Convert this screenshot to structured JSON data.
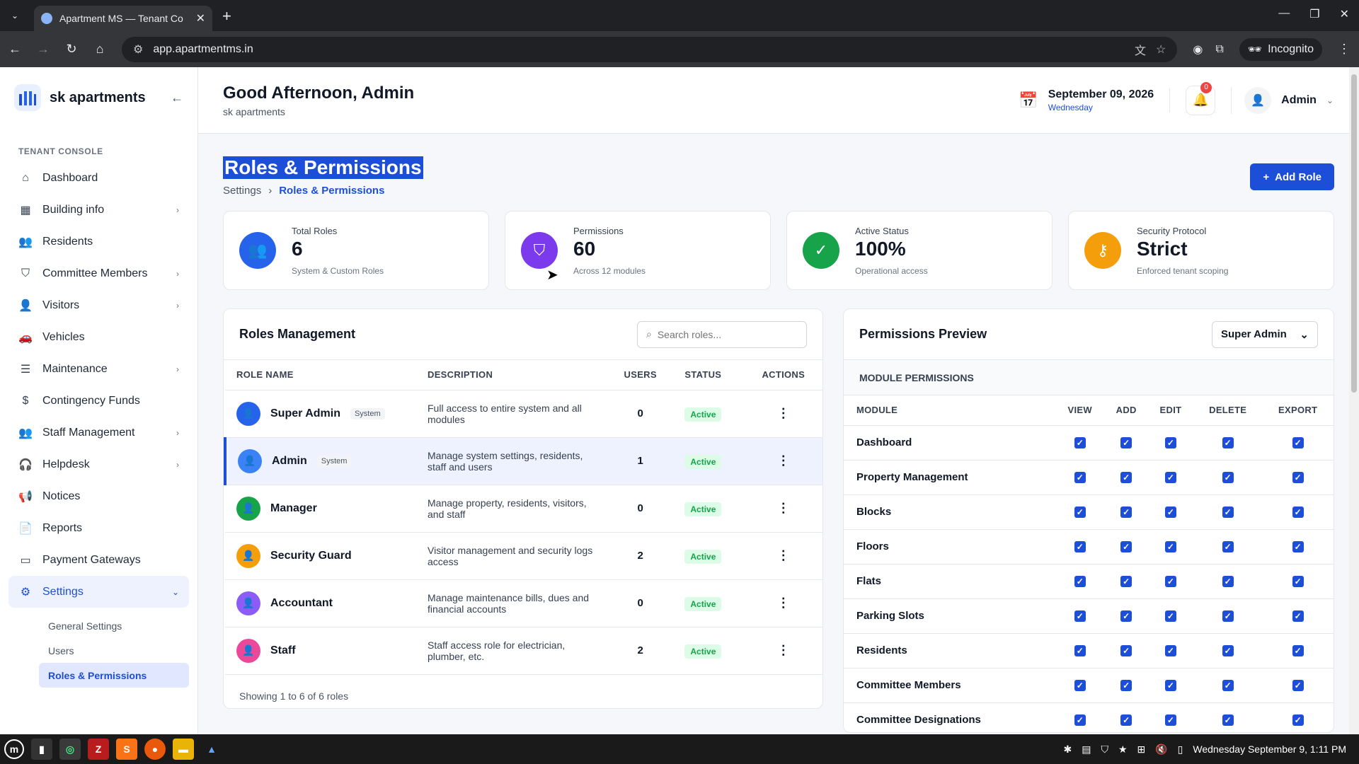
{
  "browser": {
    "tab_title": "Apartment MS — Tenant Co",
    "url": "app.apartmentms.in",
    "incognito_label": "Incognito"
  },
  "sidebar": {
    "brand": "sk apartments",
    "section": "TENANT CONSOLE",
    "items": [
      {
        "label": "Dashboard",
        "icon": "home-icon",
        "glyph": "⌂",
        "chevron": false
      },
      {
        "label": "Building info",
        "icon": "grid-icon",
        "glyph": "▦",
        "chevron": true
      },
      {
        "label": "Residents",
        "icon": "users-icon",
        "glyph": "👥",
        "chevron": false
      },
      {
        "label": "Committee Members",
        "icon": "shield-icon",
        "glyph": "⛉",
        "chevron": true
      },
      {
        "label": "Visitors",
        "icon": "user-plus-icon",
        "glyph": "👤",
        "chevron": true
      },
      {
        "label": "Vehicles",
        "icon": "car-icon",
        "glyph": "🚗",
        "chevron": false
      },
      {
        "label": "Maintenance",
        "icon": "server-icon",
        "glyph": "☰",
        "chevron": true
      },
      {
        "label": "Contingency Funds",
        "icon": "dollar-icon",
        "glyph": "$",
        "chevron": false
      },
      {
        "label": "Staff Management",
        "icon": "staff-icon",
        "glyph": "👥",
        "chevron": true
      },
      {
        "label": "Helpdesk",
        "icon": "headphones-icon",
        "glyph": "🎧",
        "chevron": true
      },
      {
        "label": "Notices",
        "icon": "megaphone-icon",
        "glyph": "📢",
        "chevron": false
      },
      {
        "label": "Reports",
        "icon": "file-icon",
        "glyph": "📄",
        "chevron": false
      },
      {
        "label": "Payment Gateways",
        "icon": "card-icon",
        "glyph": "▭",
        "chevron": false
      }
    ],
    "settings_label": "Settings",
    "sub_items": [
      "General Settings",
      "Users",
      "Roles & Permissions"
    ]
  },
  "header": {
    "greeting": "Good Afternoon, Admin",
    "subtitle": "sk apartments",
    "date": "September 09, 2026",
    "weekday": "Wednesday",
    "notif_count": "0",
    "user": "Admin"
  },
  "page": {
    "title": "Roles & Permissions",
    "breadcrumb_parent": "Settings",
    "breadcrumb_current": "Roles & Permissions",
    "add_button": "Add Role"
  },
  "stats": [
    {
      "label": "Total Roles",
      "value": "6",
      "desc": "System & Custom Roles",
      "color": "#2563eb",
      "glyph": "👥"
    },
    {
      "label": "Permissions",
      "value": "60",
      "desc": "Across 12 modules",
      "color": "#7c3aed",
      "glyph": "⛉"
    },
    {
      "label": "Active Status",
      "value": "100%",
      "desc": "Operational access",
      "color": "#16a34a",
      "glyph": "✓"
    },
    {
      "label": "Security Protocol",
      "value": "Strict",
      "desc": "Enforced tenant scoping",
      "color": "#f59e0b",
      "glyph": "⚷"
    }
  ],
  "roles": {
    "title": "Roles Management",
    "search_placeholder": "Search roles...",
    "columns": [
      "ROLE NAME",
      "DESCRIPTION",
      "USERS",
      "STATUS",
      "ACTIONS"
    ],
    "rows": [
      {
        "name": "Super Admin",
        "system": "System",
        "desc": "Full access to entire system and all modules",
        "users": "0",
        "status": "Active",
        "color": "#2563eb"
      },
      {
        "name": "Admin",
        "system": "System",
        "desc": "Manage system settings, residents, staff and users",
        "users": "1",
        "status": "Active",
        "color": "#3b82f6"
      },
      {
        "name": "Manager",
        "system": "",
        "desc": "Manage property, residents, visitors, and staff",
        "users": "0",
        "status": "Active",
        "color": "#16a34a"
      },
      {
        "name": "Security Guard",
        "system": "",
        "desc": "Visitor management and security logs access",
        "users": "2",
        "status": "Active",
        "color": "#f59e0b"
      },
      {
        "name": "Accountant",
        "system": "",
        "desc": "Manage maintenance bills, dues and financial accounts",
        "users": "0",
        "status": "Active",
        "color": "#8b5cf6"
      },
      {
        "name": "Staff",
        "system": "",
        "desc": "Staff access role for electrician, plumber, etc.",
        "users": "2",
        "status": "Active",
        "color": "#ec4899"
      }
    ],
    "footer": "Showing 1 to 6 of 6 roles"
  },
  "permissions": {
    "title": "Permissions Preview",
    "selected_role": "Super Admin",
    "section": "MODULE PERMISSIONS",
    "columns": [
      "MODULE",
      "VIEW",
      "ADD",
      "EDIT",
      "DELETE",
      "EXPORT"
    ],
    "modules": [
      "Dashboard",
      "Property Management",
      "Blocks",
      "Floors",
      "Flats",
      "Parking Slots",
      "Residents",
      "Committee Members",
      "Committee Designations"
    ]
  },
  "taskbar": {
    "clock": "Wednesday September 9, 1:11 PM"
  }
}
